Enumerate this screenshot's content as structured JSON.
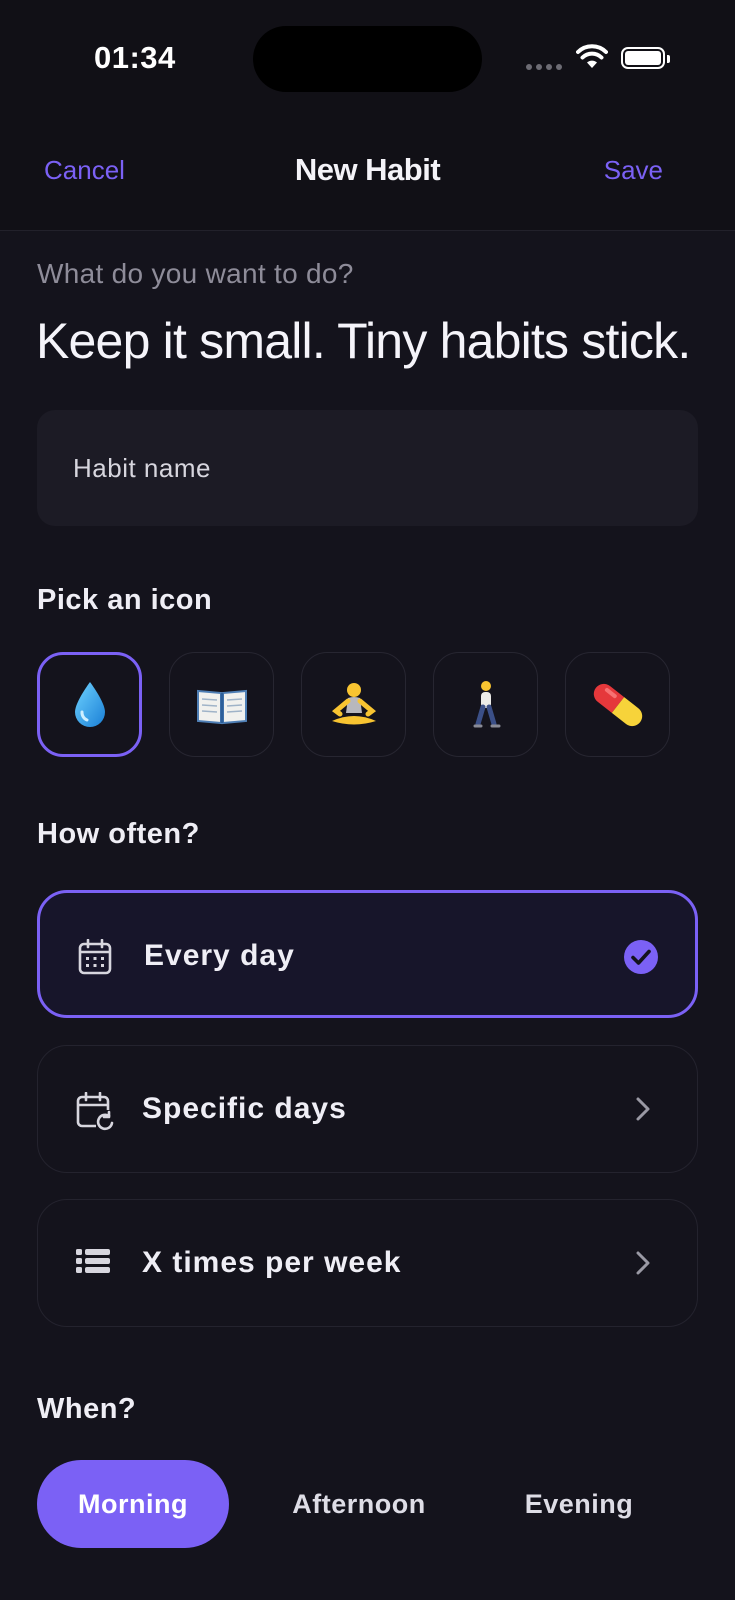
{
  "status_bar": {
    "time": "01:34"
  },
  "nav": {
    "cancel_label": "Cancel",
    "title": "New Habit",
    "save_label": "Save"
  },
  "intro": {
    "prompt": "What do you want to do?",
    "headline": "Keep it small. Tiny habits stick."
  },
  "name_field": {
    "value": "",
    "placeholder": "Habit name"
  },
  "icon_section": {
    "label": "Pick an icon",
    "icons": [
      {
        "name": "water-drop",
        "selected": true
      },
      {
        "name": "open-book",
        "selected": false
      },
      {
        "name": "meditation",
        "selected": false
      },
      {
        "name": "walking",
        "selected": false
      },
      {
        "name": "pill",
        "selected": false
      }
    ]
  },
  "frequency": {
    "label": "How often?",
    "options": [
      {
        "label": "Every day",
        "icon": "calendar-icon",
        "selected": true
      },
      {
        "label": "Specific days",
        "icon": "calendar-repeat-icon",
        "selected": false
      },
      {
        "label": "X times per week",
        "icon": "list-icon",
        "selected": false
      }
    ]
  },
  "when": {
    "label": "When?",
    "options": [
      "Morning",
      "Afternoon",
      "Evening"
    ],
    "selected": "Morning"
  },
  "colors": {
    "accent": "#7b61f5",
    "background": "#14131c",
    "card": "#1c1b25"
  }
}
